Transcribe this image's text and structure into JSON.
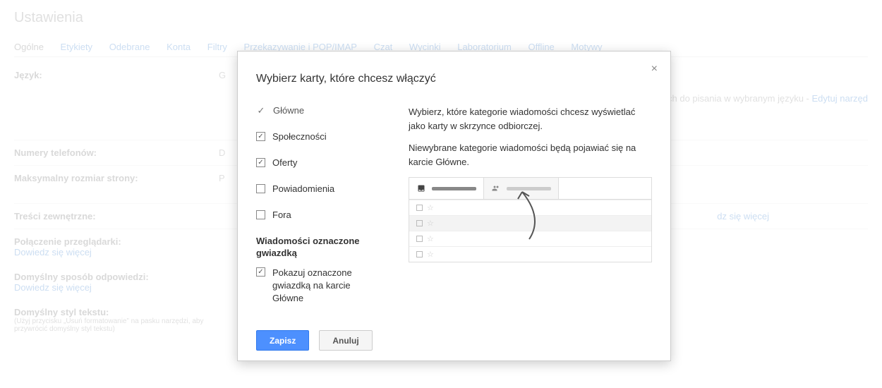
{
  "page": {
    "title": "Ustawienia",
    "tabs": [
      "Ogólne",
      "Etykiety",
      "Odebrane",
      "Konta",
      "Filtry",
      "Przekazywanie i POP/IMAP",
      "Czat",
      "Wycinki",
      "Laboratorium",
      "Offline",
      "Motywy"
    ],
    "rows": {
      "lang_label": "Język:",
      "lang_value_prefix": "G",
      "lang_tail": "ch do pisania w wybranym języku - ",
      "lang_link": "Edytuj narzęd",
      "phone_label": "Numery telefonów:",
      "phone_value": "D",
      "pagesize_label": "Maksymalny rozmiar strony:",
      "pagesize_value": "P",
      "external_label": "Treści zewnętrzne:",
      "external_link": "dz się więcej",
      "browser_label": "Połączenie przeglądarki:",
      "reply_label": "Domyślny sposób odpowiedzi:",
      "learn_more": "Dowiedz się więcej",
      "textstyle_label": "Domyślny styl tekstu:",
      "textstyle_hint": "(Użyj przycisku „Usuń formatowanie” na pasku narzędzi, aby przywrócić domyślny styl tekstu)"
    }
  },
  "modal": {
    "title": "Wybierz karty, które chcesz włączyć",
    "close_label": "×",
    "categories": {
      "primary": "Główne",
      "social": "Społeczności",
      "promotions": "Oferty",
      "updates": "Powiadomienia",
      "forums": "Fora"
    },
    "starred_header": "Wiadomości oznaczone gwiazdką",
    "starred_option": "Pokazuj oznaczone gwiazdką na karcie Główne",
    "desc1": "Wybierz, które kategorie wiadomości chcesz wyświetlać jako karty w skrzynce odbiorczej.",
    "desc2": "Niewybrane kategorie wiadomości będą pojawiać się na karcie Główne.",
    "save": "Zapisz",
    "cancel": "Anuluj"
  }
}
